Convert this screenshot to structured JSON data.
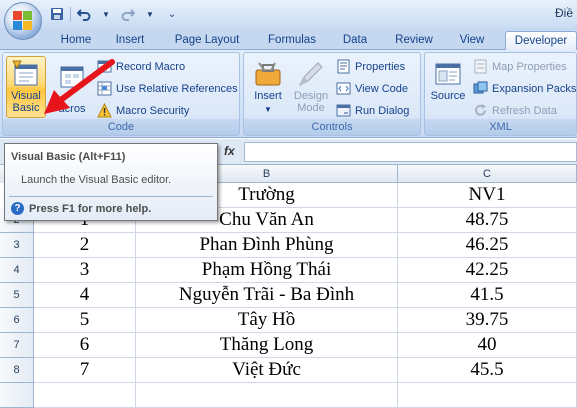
{
  "window": {
    "title": "Điề"
  },
  "tabs": [
    {
      "label": "Home"
    },
    {
      "label": "Insert"
    },
    {
      "label": "Page Layout"
    },
    {
      "label": "Formulas"
    },
    {
      "label": "Data"
    },
    {
      "label": "Review"
    },
    {
      "label": "View"
    },
    {
      "label": "Developer"
    }
  ],
  "active_tab": "Developer",
  "ribbon": {
    "code": {
      "label": "Code",
      "visual_basic": [
        "Visual",
        "Basic"
      ],
      "macros": "acros",
      "record_macro": "Record Macro",
      "use_relative": "Use Relative References",
      "macro_security": "Macro Security"
    },
    "controls": {
      "label": "Controls",
      "insert": "Insert",
      "design_mode": [
        "Design",
        "Mode"
      ],
      "properties": "Properties",
      "view_code": "View Code",
      "run_dialog": "Run Dialog"
    },
    "xml": {
      "label": "XML",
      "source": "Source",
      "map_properties": "Map Properties",
      "expansion_packs": "Expansion Packs",
      "refresh_data": "Refresh Data"
    }
  },
  "formula_bar": {
    "fx": "fx"
  },
  "columns": [
    "B",
    "C"
  ],
  "rows": [
    "2",
    "3",
    "4",
    "5",
    "6",
    "7",
    "8"
  ],
  "table": {
    "header": [
      "Trường",
      "NV1"
    ],
    "rows": [
      {
        "a": "1",
        "b": "Chu Văn An",
        "c": "48.75"
      },
      {
        "a": "2",
        "b": "Phan Đình Phùng",
        "c": "46.25"
      },
      {
        "a": "3",
        "b": "Phạm Hồng Thái",
        "c": "42.25"
      },
      {
        "a": "4",
        "b": "Nguyễn Trãi - Ba Đình",
        "c": "41.5"
      },
      {
        "a": "5",
        "b": "Tây Hồ",
        "c": "39.75"
      },
      {
        "a": "6",
        "b": "Thăng Long",
        "c": "40"
      },
      {
        "a": "7",
        "b": "Việt Đức",
        "c": "45.5"
      }
    ]
  },
  "tooltip": {
    "title": "Visual Basic (Alt+F11)",
    "body": "Launch the Visual Basic editor.",
    "help": "Press F1 for more help."
  },
  "colors": {
    "accent": "#15428b",
    "arrow": "#e8141c",
    "highlight": "#ffc53f"
  }
}
